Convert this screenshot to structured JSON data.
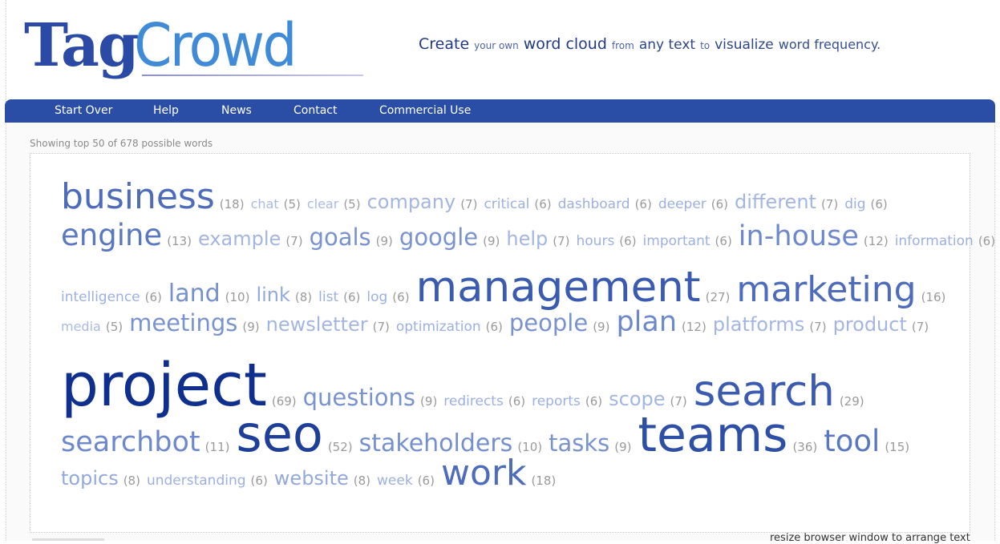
{
  "logo": {
    "part1": "Tag",
    "part2": "Crowd"
  },
  "tagline": [
    {
      "text": "Create",
      "size": "lg"
    },
    {
      "text": "your own",
      "size": "sm"
    },
    {
      "text": "word cloud",
      "size": "lg"
    },
    {
      "text": "from",
      "size": "sm"
    },
    {
      "text": "any text",
      "size": "md"
    },
    {
      "text": "to",
      "size": "sm"
    },
    {
      "text": "visualize",
      "size": "md"
    },
    {
      "text": "word frequency.",
      "size": "fq"
    }
  ],
  "nav": {
    "items": [
      "Start Over",
      "Help",
      "News",
      "Contact",
      "Commercial Use"
    ],
    "color": "#2a4ea6"
  },
  "status": {
    "showing": "Showing top 50 of 678 possible words"
  },
  "cloud": {
    "rows": [
      [
        [
          "business",
          18
        ],
        [
          "chat",
          5
        ],
        [
          "clear",
          5
        ],
        [
          "company",
          7
        ],
        [
          "critical",
          6
        ],
        [
          "dashboard",
          6
        ],
        [
          "deeper",
          6
        ],
        [
          "different",
          7
        ],
        [
          "dig",
          6
        ]
      ],
      [
        [
          "engine",
          13
        ],
        [
          "example",
          7
        ],
        [
          "goals",
          9
        ],
        [
          "google",
          9
        ],
        [
          "help",
          7
        ],
        [
          "hours",
          6
        ],
        [
          "important",
          6
        ],
        [
          "in-house",
          12
        ],
        [
          "information",
          6
        ]
      ],
      [
        [
          "intelligence",
          6
        ],
        [
          "land",
          10
        ],
        [
          "link",
          8
        ],
        [
          "list",
          6
        ],
        [
          "log",
          6
        ],
        [
          "management",
          27
        ],
        [
          "marketing",
          16
        ]
      ],
      [
        [
          "media",
          5
        ],
        [
          "meetings",
          9
        ],
        [
          "newsletter",
          7
        ],
        [
          "optimization",
          6
        ],
        [
          "people",
          9
        ],
        [
          "plan",
          12
        ],
        [
          "platforms",
          7
        ],
        [
          "product",
          7
        ]
      ],
      [
        [
          "project",
          69
        ],
        [
          "questions",
          9
        ],
        [
          "redirects",
          6
        ],
        [
          "reports",
          6
        ],
        [
          "scope",
          7
        ],
        [
          "search",
          29
        ]
      ],
      [
        [
          "searchbot",
          11
        ],
        [
          "seo",
          52
        ],
        [
          "stakeholders",
          10
        ],
        [
          "tasks",
          9
        ],
        [
          "teams",
          36
        ],
        [
          "tool",
          15
        ]
      ],
      [
        [
          "topics",
          8
        ],
        [
          "understanding",
          6
        ],
        [
          "website",
          8
        ],
        [
          "week",
          6
        ],
        [
          "work",
          18
        ]
      ]
    ]
  },
  "footer": {
    "resize_note": "resize browser window to arrange text"
  }
}
